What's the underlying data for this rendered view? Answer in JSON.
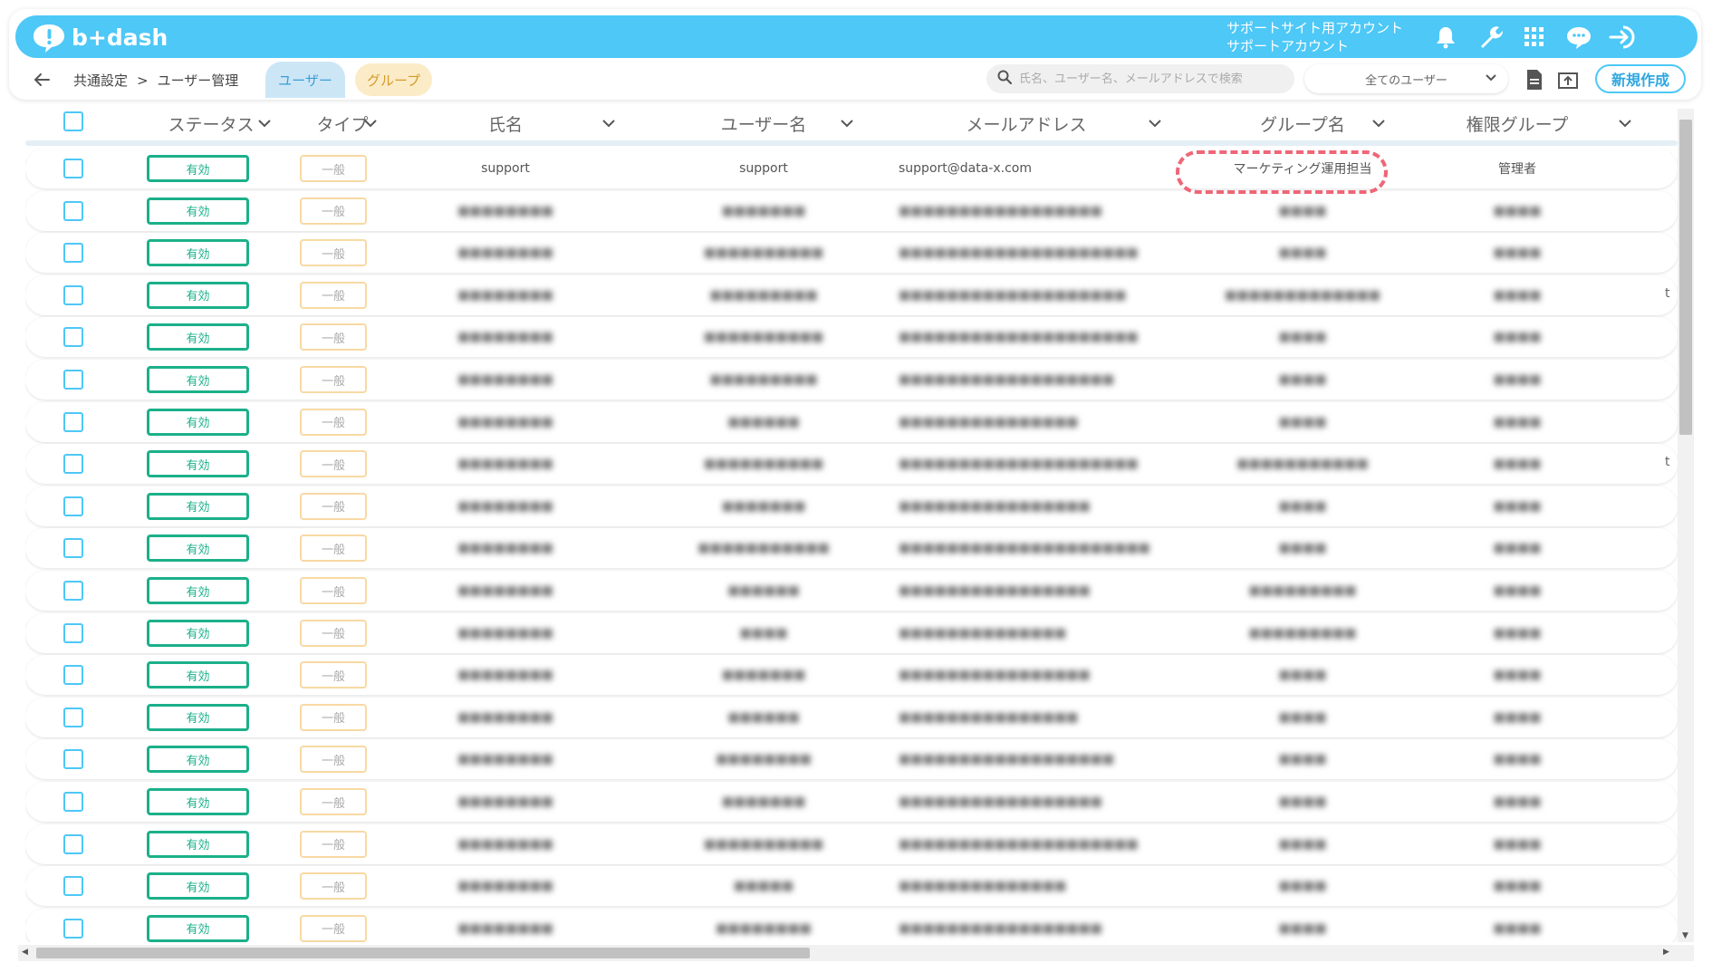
{
  "app": {
    "logo_text": "b+dash",
    "account_line1": "サポートサイト用アカウント",
    "account_line2": "サポートアカウント",
    "accent": "#4dc8f7"
  },
  "header_icons": [
    "bell-icon",
    "wrench-icon",
    "grid-icon",
    "chat-icon",
    "logout-icon"
  ],
  "breadcrumb": {
    "root": "共通設定",
    "separator": ">",
    "current": "ユーザー管理"
  },
  "tabs": {
    "user": "ユーザー",
    "group": "グループ"
  },
  "search": {
    "placeholder": "氏名、ユーザー名、メールアドレスで検索",
    "value": ""
  },
  "filter": {
    "selected": "全てのユーザー"
  },
  "toolbar": {
    "new_label": "新規作成"
  },
  "columns": {
    "status": "ステータス",
    "type": "タイプ",
    "name": "氏名",
    "username": "ユーザー名",
    "email": "メールアドレス",
    "group": "グループ名",
    "role": "権限グループ"
  },
  "rows": [
    {
      "status": "有効",
      "type": "一般",
      "name": "support",
      "username": "support",
      "email": "support@data-x.com",
      "group": "マーケティング運用担当",
      "role": "管理者",
      "blurred": false,
      "trunc": ""
    },
    {
      "status": "有効",
      "type": "一般",
      "name": "■■■■■■■■",
      "username": "■■■■■■■",
      "email": "■■■■■■■■■■■■■■■■■",
      "group": "■■■■",
      "role": "■■■■",
      "blurred": true,
      "trunc": ""
    },
    {
      "status": "有効",
      "type": "一般",
      "name": "■■■■■■■■",
      "username": "■■■■■■■■■■",
      "email": "■■■■■■■■■■■■■■■■■■■■",
      "group": "■■■■",
      "role": "■■■■",
      "blurred": true,
      "trunc": ""
    },
    {
      "status": "有効",
      "type": "一般",
      "name": "■■■■■■■■",
      "username": "■■■■■■■■■",
      "email": "■■■■■■■■■■■■■■■■■■■",
      "group": "■■■■■■■■■■■■■",
      "role": "■■■■",
      "blurred": true,
      "trunc": "t"
    },
    {
      "status": "有効",
      "type": "一般",
      "name": "■■■■■■■■",
      "username": "■■■■■■■■■■",
      "email": "■■■■■■■■■■■■■■■■■■■■",
      "group": "■■■■",
      "role": "■■■■",
      "blurred": true,
      "trunc": ""
    },
    {
      "status": "有効",
      "type": "一般",
      "name": "■■■■■■■■",
      "username": "■■■■■■■■■",
      "email": "■■■■■■■■■■■■■■■■■■",
      "group": "■■■■",
      "role": "■■■■",
      "blurred": true,
      "trunc": ""
    },
    {
      "status": "有効",
      "type": "一般",
      "name": "■■■■■■■■",
      "username": "■■■■■■",
      "email": "■■■■■■■■■■■■■■■",
      "group": "■■■■",
      "role": "■■■■",
      "blurred": true,
      "trunc": ""
    },
    {
      "status": "有効",
      "type": "一般",
      "name": "■■■■■■■■",
      "username": "■■■■■■■■■■",
      "email": "■■■■■■■■■■■■■■■■■■■■",
      "group": "■■■■■■■■■■■",
      "role": "■■■■",
      "blurred": true,
      "trunc": "t"
    },
    {
      "status": "有効",
      "type": "一般",
      "name": "■■■■■■■■",
      "username": "■■■■■■■",
      "email": "■■■■■■■■■■■■■■■■",
      "group": "■■■■",
      "role": "■■■■",
      "blurred": true,
      "trunc": ""
    },
    {
      "status": "有効",
      "type": "一般",
      "name": "■■■■■■■■",
      "username": "■■■■■■■■■■■",
      "email": "■■■■■■■■■■■■■■■■■■■■■",
      "group": "■■■■",
      "role": "■■■■",
      "blurred": true,
      "trunc": ""
    },
    {
      "status": "有効",
      "type": "一般",
      "name": "■■■■■■■■",
      "username": "■■■■■■",
      "email": "■■■■■■■■■■■■■■■■",
      "group": "■■■■■■■■■",
      "role": "■■■■",
      "blurred": true,
      "trunc": ""
    },
    {
      "status": "有効",
      "type": "一般",
      "name": "■■■■■■■■",
      "username": "■■■■",
      "email": "■■■■■■■■■■■■■■",
      "group": "■■■■■■■■■",
      "role": "■■■■",
      "blurred": true,
      "trunc": ""
    },
    {
      "status": "有効",
      "type": "一般",
      "name": "■■■■■■■■",
      "username": "■■■■■■■",
      "email": "■■■■■■■■■■■■■■■■",
      "group": "■■■■",
      "role": "■■■■",
      "blurred": true,
      "trunc": ""
    },
    {
      "status": "有効",
      "type": "一般",
      "name": "■■■■■■■■",
      "username": "■■■■■■",
      "email": "■■■■■■■■■■■■■■■",
      "group": "■■■■",
      "role": "■■■■",
      "blurred": true,
      "trunc": ""
    },
    {
      "status": "有効",
      "type": "一般",
      "name": "■■■■■■■■",
      "username": "■■■■■■■■",
      "email": "■■■■■■■■■■■■■■■■■■",
      "group": "■■■■",
      "role": "■■■■",
      "blurred": true,
      "trunc": ""
    },
    {
      "status": "有効",
      "type": "一般",
      "name": "■■■■■■■■",
      "username": "■■■■■■■",
      "email": "■■■■■■■■■■■■■■■■■",
      "group": "■■■■",
      "role": "■■■■",
      "blurred": true,
      "trunc": ""
    },
    {
      "status": "有効",
      "type": "一般",
      "name": "■■■■■■■■",
      "username": "■■■■■■■■■■",
      "email": "■■■■■■■■■■■■■■■■■■■■",
      "group": "■■■■",
      "role": "■■■■",
      "blurred": true,
      "trunc": ""
    },
    {
      "status": "有効",
      "type": "一般",
      "name": "■■■■■■■■",
      "username": "■■■■■",
      "email": "■■■■■■■■■■■■■■",
      "group": "■■■■",
      "role": "■■■■",
      "blurred": true,
      "trunc": ""
    },
    {
      "status": "有効",
      "type": "一般",
      "name": "■■■■■■■■",
      "username": "■■■■■■■■",
      "email": "■■■■■■■■■■■■■■■■■",
      "group": "■■■■",
      "role": "■■■■",
      "blurred": true,
      "trunc": ""
    }
  ]
}
